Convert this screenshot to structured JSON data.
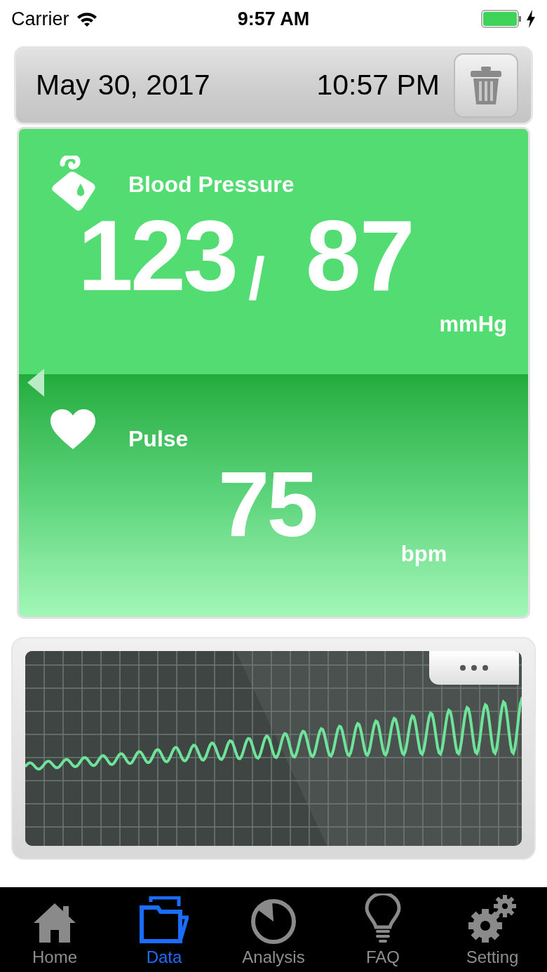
{
  "status_bar": {
    "carrier": "Carrier",
    "time": "9:57 AM",
    "charging": true
  },
  "record": {
    "date": "May 30, 2017",
    "time": "10:57 PM"
  },
  "blood_pressure": {
    "label": "Blood Pressure",
    "systolic": "123",
    "separator": "/",
    "diastolic": "87",
    "unit": "mmHg"
  },
  "pulse": {
    "label": "Pulse",
    "value": "75",
    "unit": "bpm"
  },
  "tabs": [
    {
      "label": "Home",
      "selected": false
    },
    {
      "label": "Data",
      "selected": true
    },
    {
      "label": "Analysis",
      "selected": false
    },
    {
      "label": "FAQ",
      "selected": false
    },
    {
      "label": "Setting",
      "selected": false
    }
  ]
}
